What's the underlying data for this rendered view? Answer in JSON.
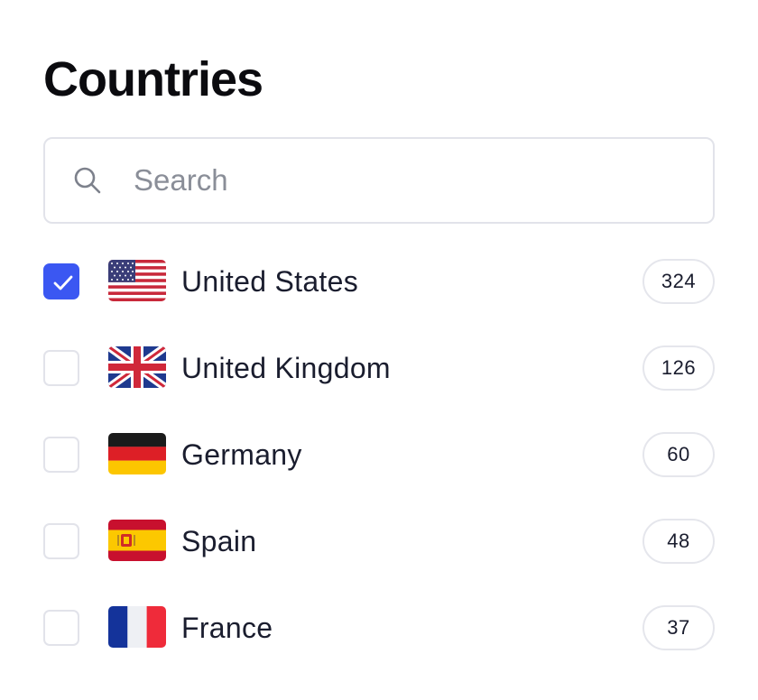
{
  "title": "Countries",
  "search": {
    "placeholder": "Search",
    "value": "",
    "icon": "search-icon"
  },
  "accent_color": "#3b57f2",
  "countries": [
    {
      "name": "United States",
      "count": "324",
      "checked": true,
      "flag": "us-flag-icon"
    },
    {
      "name": "United Kingdom",
      "count": "126",
      "checked": false,
      "flag": "uk-flag-icon"
    },
    {
      "name": "Germany",
      "count": "60",
      "checked": false,
      "flag": "germany-flag-icon"
    },
    {
      "name": "Spain",
      "count": "48",
      "checked": false,
      "flag": "spain-flag-icon"
    },
    {
      "name": "France",
      "count": "37",
      "checked": false,
      "flag": "france-flag-icon"
    }
  ]
}
